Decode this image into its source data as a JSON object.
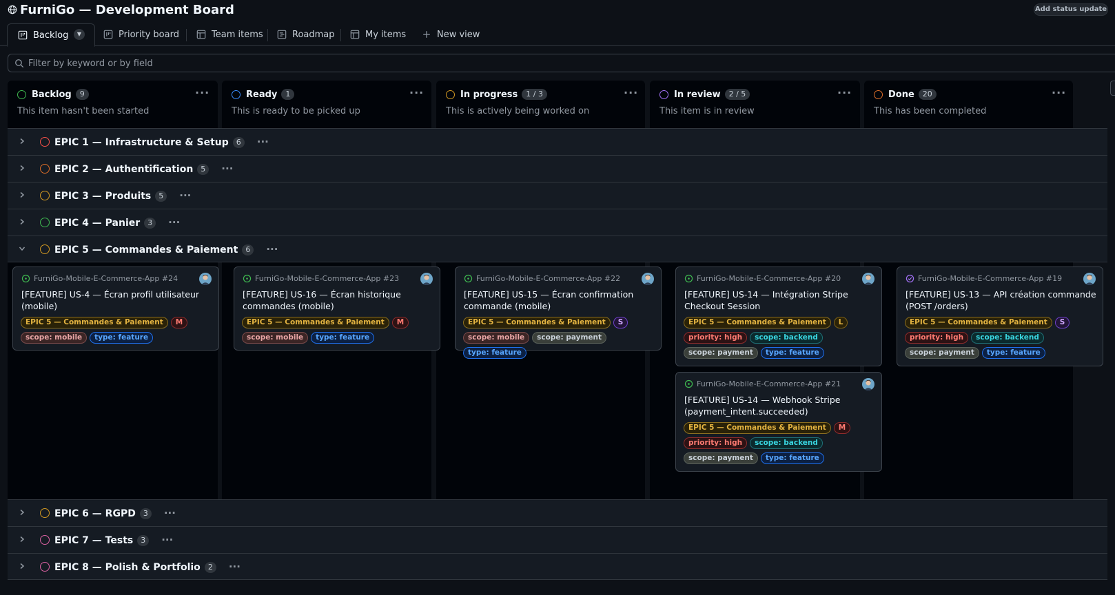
{
  "header": {
    "title": "FurniGo — Development Board",
    "status_button": "Add status update"
  },
  "tabs": [
    {
      "label": "Backlog"
    },
    {
      "label": "Priority board"
    },
    {
      "label": "Team items"
    },
    {
      "label": "Roadmap"
    },
    {
      "label": "My items"
    },
    {
      "label": "New view"
    }
  ],
  "filter": {
    "placeholder": "Filter by keyword or by field",
    "value": ""
  },
  "columns": [
    {
      "name": "Backlog",
      "count": "9",
      "description": "This item hasn't been started",
      "color": "#3fb950"
    },
    {
      "name": "Ready",
      "count": "1",
      "description": "This is ready to be picked up",
      "color": "#388bfd"
    },
    {
      "name": "In progress",
      "count": "1 / 3",
      "description": "This is actively being worked on",
      "color": "#d29922"
    },
    {
      "name": "In review",
      "count": "2 / 5",
      "description": "This item is in review",
      "color": "#a371f7"
    },
    {
      "name": "Done",
      "count": "20",
      "description": "This has been completed",
      "color": "#db6d28"
    }
  ],
  "epics": [
    {
      "name": "EPIC 1 — Infrastructure & Setup",
      "count": "6",
      "color": "#f85149"
    },
    {
      "name": "EPIC 2 — Authentification",
      "count": "5",
      "color": "#db6d28"
    },
    {
      "name": "EPIC 3 — Produits",
      "count": "5",
      "color": "#d29922"
    },
    {
      "name": "EPIC 4 — Panier",
      "count": "3",
      "color": "#3fb950"
    },
    {
      "name": "EPIC 5 — Commandes & Paiement",
      "count": "6",
      "color": "#d29922"
    },
    {
      "name": "EPIC 6 — RGPD",
      "count": "3",
      "color": "#d29922"
    },
    {
      "name": "EPIC 7 — Tests",
      "count": "3",
      "color": "#db61a2"
    },
    {
      "name": "EPIC 8 — Polish & Portfolio",
      "count": "2",
      "color": "#db61a2"
    }
  ],
  "cards": [
    {
      "repo": "FurniGo-Mobile-E-Commerce-App #24",
      "title": "[FEATURE] US-4 — Écran profil utilisateur (mobile)",
      "status_icon": "open-issue-icon",
      "labels": [
        "EPIC 5 — Commandes & Paiement",
        "M",
        "scope: mobile",
        "type: feature"
      ]
    },
    {
      "repo": "FurniGo-Mobile-E-Commerce-App #23",
      "title": "[FEATURE] US-16 — Écran historique commandes (mobile)",
      "status_icon": "open-issue-icon",
      "labels": [
        "EPIC 5 — Commandes & Paiement",
        "M",
        "scope: mobile",
        "type: feature"
      ]
    },
    {
      "repo": "FurniGo-Mobile-E-Commerce-App #22",
      "title": "[FEATURE] US-15 — Écran confirmation commande (mobile)",
      "status_icon": "open-issue-icon",
      "labels": [
        "EPIC 5 — Commandes & Paiement",
        "S",
        "scope: mobile",
        "scope: payment",
        "type: feature"
      ]
    },
    {
      "repo": "FurniGo-Mobile-E-Commerce-App #20",
      "title": "[FEATURE] US-14 — Intégration Stripe Checkout Session",
      "status_icon": "open-issue-icon",
      "labels": [
        "EPIC 5 — Commandes & Paiement",
        "L",
        "priority: high",
        "scope: backend",
        "scope: payment",
        "type: feature"
      ]
    },
    {
      "repo": "FurniGo-Mobile-E-Commerce-App #21",
      "title": "[FEATURE] US-14 — Webhook Stripe (payment_intent.succeeded)",
      "status_icon": "open-issue-icon",
      "labels": [
        "EPIC 5 — Commandes & Paiement",
        "M",
        "priority: high",
        "scope: backend",
        "scope: payment",
        "type: feature"
      ]
    },
    {
      "repo": "FurniGo-Mobile-E-Commerce-App #19",
      "title": "[FEATURE] US-13 — API création commande (POST /orders)",
      "status_icon": "closed-issue-icon",
      "labels": [
        "EPIC 5 — Commandes & Paiement",
        "S",
        "priority: high",
        "scope: backend",
        "scope: payment",
        "type: feature"
      ]
    }
  ]
}
